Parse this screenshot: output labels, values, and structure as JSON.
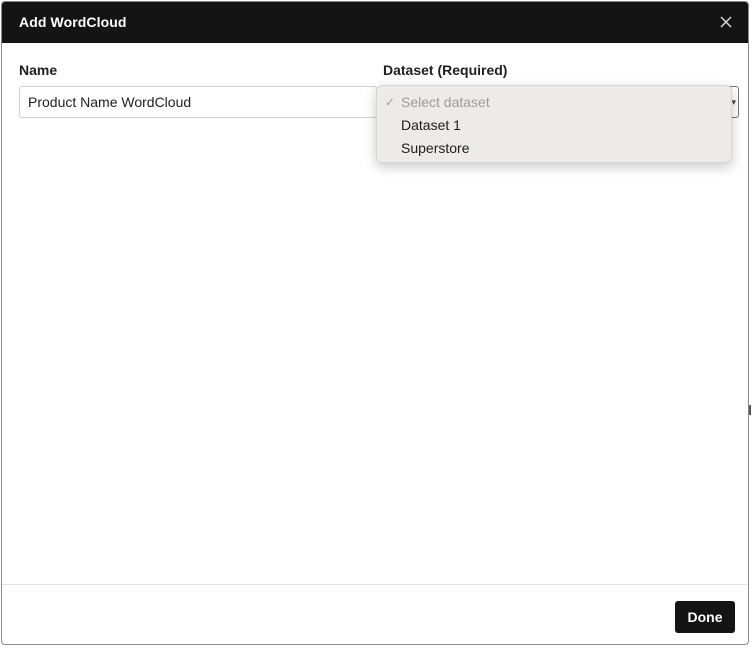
{
  "dialog": {
    "title": "Add WordCloud",
    "close_icon": "close-icon"
  },
  "form": {
    "name_label": "Name",
    "name_value": "Product Name WordCloud",
    "dataset_label": "Dataset (Required)"
  },
  "dataset_dropdown": {
    "check_icon": "✓",
    "placeholder": "Select dataset",
    "options": [
      "Dataset 1",
      "Superstore"
    ],
    "selected": "Select dataset"
  },
  "footer": {
    "done_label": "Done"
  },
  "colors": {
    "titlebar": "#141414",
    "button": "#141414",
    "dropdown_bg": "#ecebea"
  }
}
